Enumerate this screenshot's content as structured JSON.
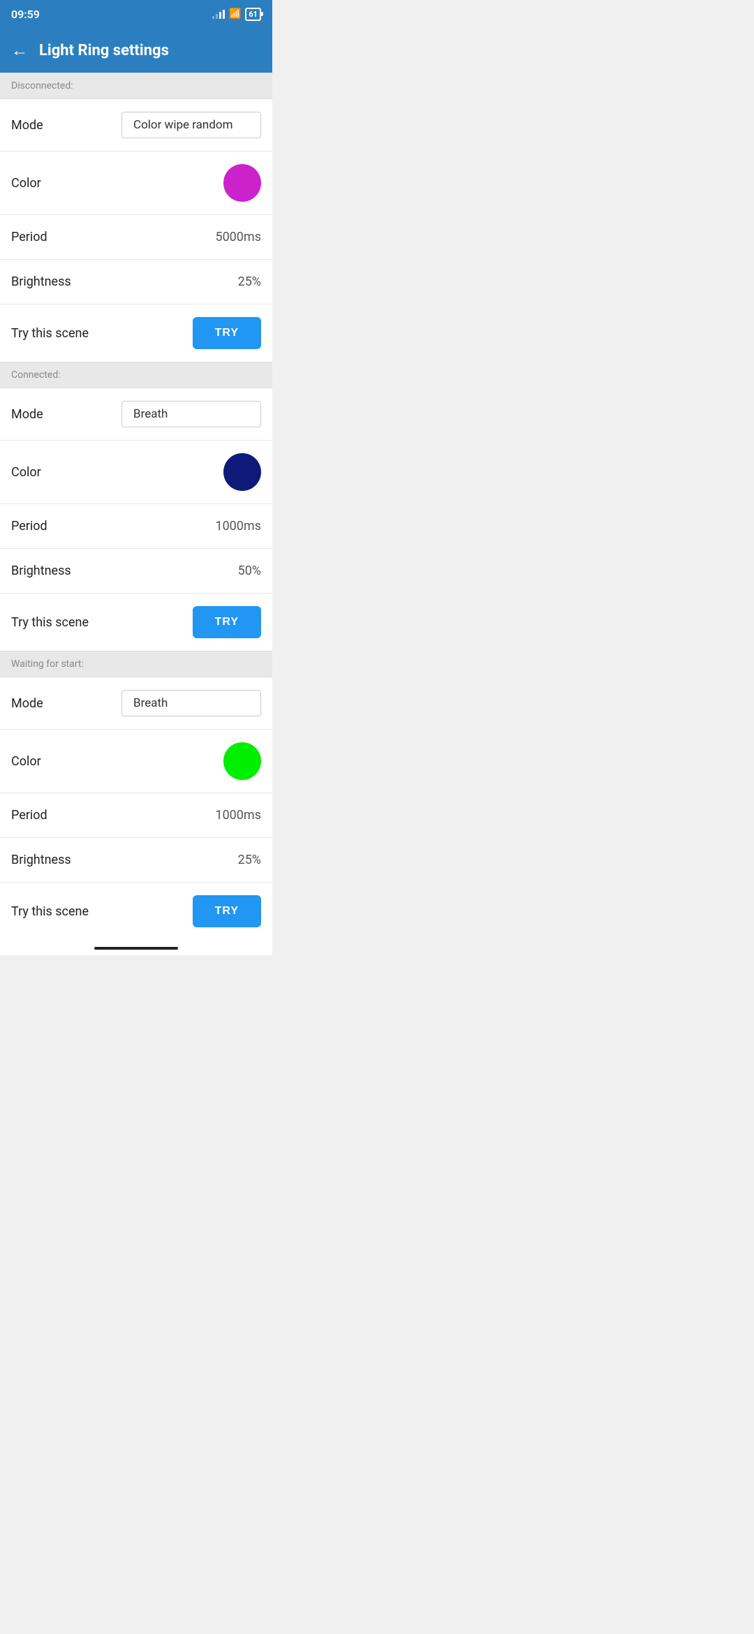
{
  "statusBar": {
    "time": "09:59",
    "battery": "61"
  },
  "appBar": {
    "title": "Light Ring settings",
    "backLabel": "←"
  },
  "sections": [
    {
      "id": "disconnected",
      "header": "Disconnected:",
      "rows": [
        {
          "id": "mode",
          "label": "Mode",
          "type": "input",
          "value": "Color wipe random"
        },
        {
          "id": "color",
          "label": "Color",
          "type": "color",
          "value": "#cc22cc"
        },
        {
          "id": "period",
          "label": "Period",
          "type": "text",
          "value": "5000ms"
        },
        {
          "id": "brightness",
          "label": "Brightness",
          "type": "text",
          "value": "25%"
        },
        {
          "id": "try",
          "label": "Try this scene",
          "type": "try",
          "buttonLabel": "TRY"
        }
      ]
    },
    {
      "id": "connected",
      "header": "Connected:",
      "rows": [
        {
          "id": "mode",
          "label": "Mode",
          "type": "input",
          "value": "Breath"
        },
        {
          "id": "color",
          "label": "Color",
          "type": "color",
          "value": "#0d1a7a"
        },
        {
          "id": "period",
          "label": "Period",
          "type": "text",
          "value": "1000ms"
        },
        {
          "id": "brightness",
          "label": "Brightness",
          "type": "text",
          "value": "50%"
        },
        {
          "id": "try",
          "label": "Try this scene",
          "type": "try",
          "buttonLabel": "TRY"
        }
      ]
    },
    {
      "id": "waiting",
      "header": "Waiting for start:",
      "rows": [
        {
          "id": "mode",
          "label": "Mode",
          "type": "input",
          "value": "Breath"
        },
        {
          "id": "color",
          "label": "Color",
          "type": "color",
          "value": "#00ee00"
        },
        {
          "id": "period",
          "label": "Period",
          "type": "text",
          "value": "1000ms"
        },
        {
          "id": "brightness",
          "label": "Brightness",
          "type": "text",
          "value": "25%"
        },
        {
          "id": "try",
          "label": "Try this scene",
          "type": "try",
          "buttonLabel": "TRY"
        }
      ]
    }
  ]
}
